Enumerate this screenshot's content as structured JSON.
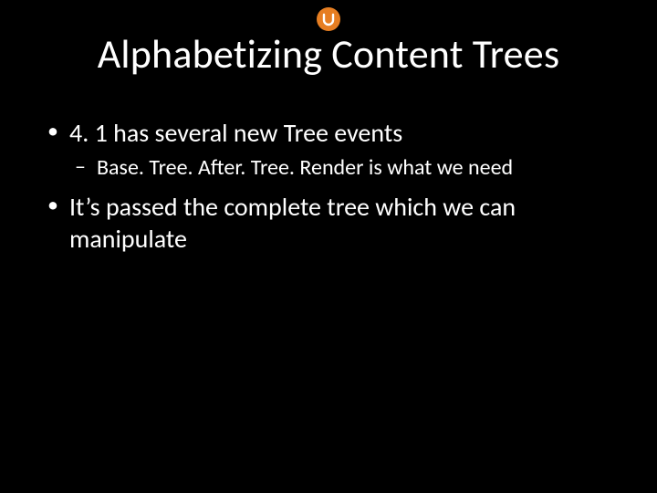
{
  "logo": {
    "name": "umbraco-logo"
  },
  "title": "Alphabetizing Content Trees",
  "bullets": [
    {
      "text": "4. 1 has several new Tree events",
      "children": [
        {
          "text": "Base. Tree. After. Tree. Render is what we need"
        }
      ]
    },
    {
      "text": "It’s passed the complete tree which we can manipulate",
      "children": []
    }
  ]
}
